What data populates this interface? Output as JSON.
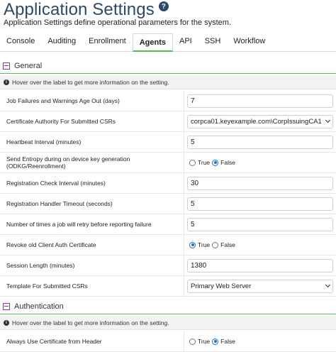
{
  "header": {
    "title": "Application Settings",
    "help_icon": "?",
    "subtitle": "Application Settings define operational parameters for the system."
  },
  "tabs": [
    {
      "label": "Console",
      "active": false
    },
    {
      "label": "Auditing",
      "active": false
    },
    {
      "label": "Enrollment",
      "active": false
    },
    {
      "label": "Agents",
      "active": true
    },
    {
      "label": "API",
      "active": false
    },
    {
      "label": "SSH",
      "active": false
    },
    {
      "label": "Workflow",
      "active": false
    }
  ],
  "sections": {
    "general": {
      "title": "General",
      "info": "Hover over the label to get more information on the setting.",
      "settings": [
        {
          "label": "Job Failures and Warnings Age Out (days)",
          "type": "text",
          "value": "7"
        },
        {
          "label": "Certificate Authority For Submitted CSRs",
          "type": "select",
          "value": "corpca01.keyexample.com\\CorpIssuingCA1"
        },
        {
          "label": "Heartbeat Interval (minutes)",
          "type": "text",
          "value": "5"
        },
        {
          "label": "Send Entropy during on device key generation (ODKG/Reenrollment)",
          "type": "radio",
          "true_label": "True",
          "false_label": "False",
          "value": "False"
        },
        {
          "label": "Registration Check Interval (minutes)",
          "type": "text",
          "value": "30"
        },
        {
          "label": "Registration Handler Timeout (seconds)",
          "type": "text",
          "value": "5"
        },
        {
          "label": "Number of times a job will retry before reporting failure",
          "type": "text",
          "value": "5"
        },
        {
          "label": "Revoke old Client Auth Certificate",
          "type": "radio",
          "true_label": "True",
          "false_label": "False",
          "value": "True"
        },
        {
          "label": "Session Length (minutes)",
          "type": "text",
          "value": "1380"
        },
        {
          "label": "Template For Submitted CSRs",
          "type": "select",
          "value": "Primary Web Server"
        }
      ]
    },
    "authentication": {
      "title": "Authentication",
      "info": "Hover over the label to get more information on the setting.",
      "settings": [
        {
          "label": "Always Use Certificate from Header",
          "type": "radio",
          "true_label": "True",
          "false_label": "False",
          "value": "False"
        }
      ]
    }
  },
  "colors": {
    "title": "#2b4a6a",
    "accent_green": "#5cb85c",
    "radio_selected": "#1a6dd6",
    "collapse_icon": "#8a3a9a"
  }
}
